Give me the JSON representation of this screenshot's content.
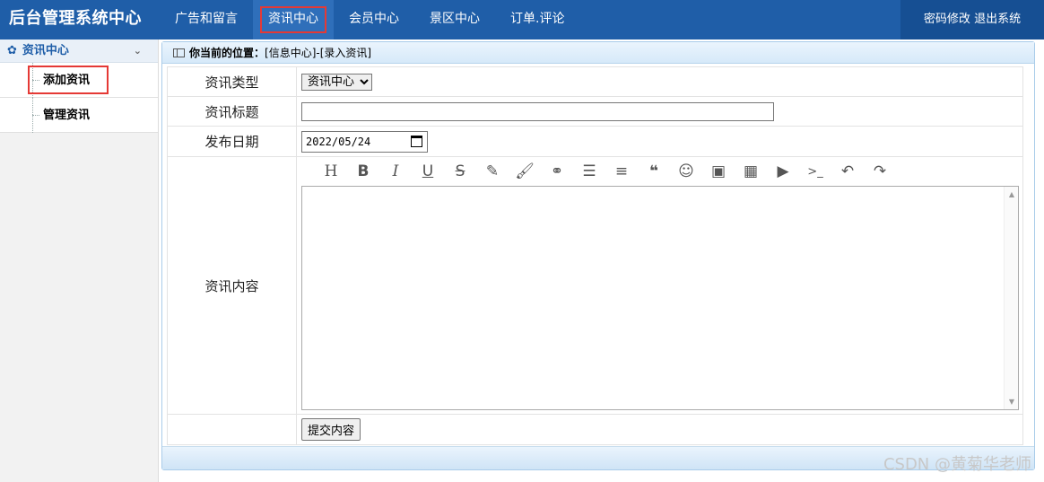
{
  "header": {
    "brand": "后台管理系统中心",
    "nav": [
      {
        "label": "广告和留言"
      },
      {
        "label": "资讯中心",
        "active": true
      },
      {
        "label": "会员中心"
      },
      {
        "label": "景区中心"
      },
      {
        "label": "订单.评论"
      }
    ],
    "change_password": "密码修改",
    "logout": "退出系统"
  },
  "sidebar": {
    "section_title": "资讯中心",
    "items": [
      {
        "label": "添加资讯",
        "active": true
      },
      {
        "label": "管理资讯"
      }
    ]
  },
  "breadcrumb": {
    "prefix": "你当前的位置：",
    "path": "[信息中心]-[录入资讯]"
  },
  "form": {
    "type_label": "资讯类型",
    "type_selected": "资讯中心",
    "title_label": "资讯标题",
    "title_value": "",
    "date_label": "发布日期",
    "date_value": "2022/05/24",
    "content_label": "资讯内容",
    "toolbar_icons": [
      "heading-icon",
      "bold-icon",
      "italic-icon",
      "underline-icon",
      "strikethrough-icon",
      "highlighter-icon",
      "brush-icon",
      "link-icon",
      "list-icon",
      "align-icon",
      "quote-icon",
      "emoji-icon",
      "image-icon",
      "table-icon",
      "video-icon",
      "code-icon",
      "undo-icon",
      "redo-icon"
    ],
    "submit_label": "提交内容"
  },
  "watermark": "CSDN @黄菊华老师",
  "colors": {
    "header_bg": "#1f5ea8",
    "highlight_border": "#e53935",
    "sidebar_title": "#1f5ea8"
  }
}
